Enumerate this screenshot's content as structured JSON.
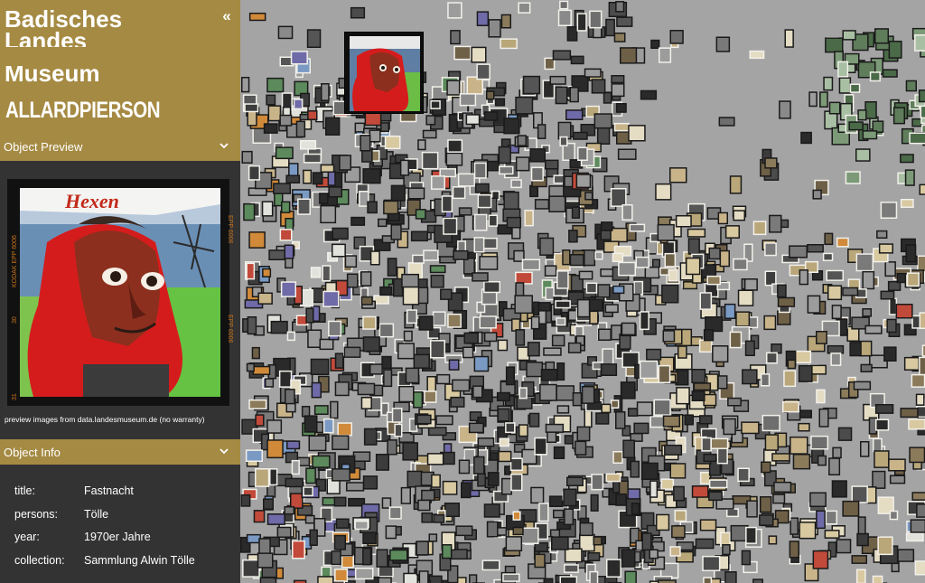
{
  "logo": {
    "line1": "Badisches",
    "line2": "Landes",
    "line3": "Museum",
    "allard": "ALLARDPIERSON",
    "collapse_icon": "double-chevron-left-icon"
  },
  "sections": {
    "preview": {
      "label": "Object Preview",
      "icon": "chevron-down-icon"
    },
    "info": {
      "label": "Object Info",
      "icon": "chevron-down-icon"
    }
  },
  "preview": {
    "caption": "preview images from data.landesmuseum.de (no warranty)",
    "sign_text": "Hexen",
    "film_text": "KODAK EPP 6006"
  },
  "info": {
    "rows": [
      {
        "key": "title:",
        "value": "Fastnacht"
      },
      {
        "key": "persons:",
        "value": "Tölle"
      },
      {
        "key": "year:",
        "value": "1970er Jahre"
      },
      {
        "key": "collection:",
        "value": "Sammlung Alwin Tölle"
      }
    ]
  },
  "colors": {
    "accent": "#a58a43",
    "sidebar_bg": "#333333",
    "map_bg": "#a4a4a4"
  }
}
